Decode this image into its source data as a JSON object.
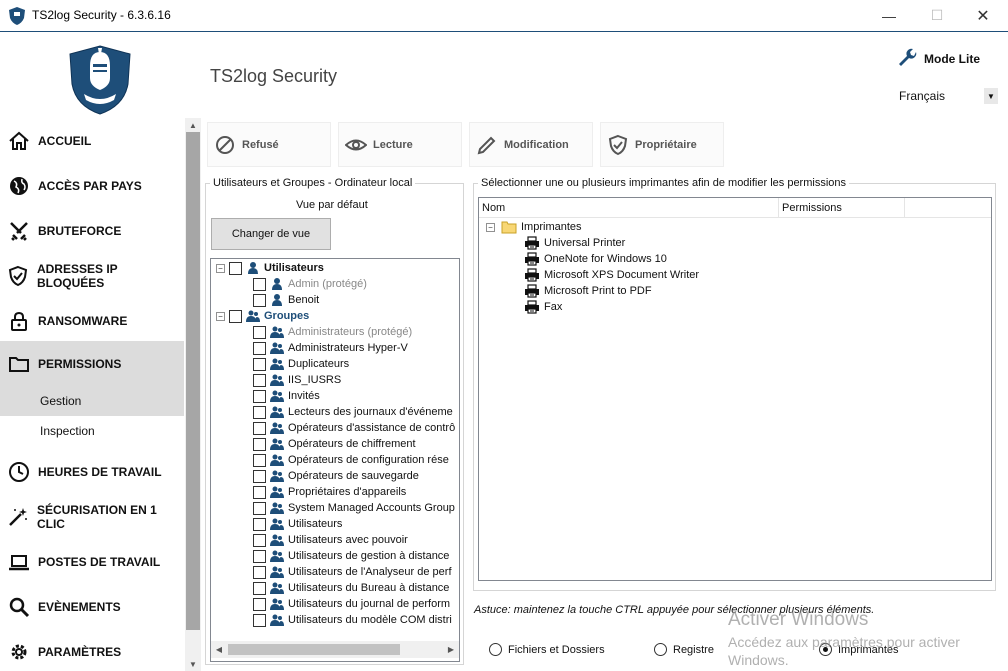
{
  "window": {
    "title": "TS2log Security - 6.3.6.16",
    "minimize_glyph": "—",
    "maximize_glyph": "☐",
    "close_glyph": "✕"
  },
  "header": {
    "app_name": "TS2log Security",
    "mode_lite": "Mode Lite",
    "language": "Français"
  },
  "sidebar": {
    "items": [
      {
        "label": "ACCUEIL",
        "icon": "home-icon"
      },
      {
        "label": "ACCÈS PAR PAYS",
        "icon": "globe-icon"
      },
      {
        "label": "BRUTEFORCE",
        "icon": "swords-icon"
      },
      {
        "label": "ADRESSES IP BLOQUÉES",
        "icon": "shield-check-icon"
      },
      {
        "label": "RANSOMWARE",
        "icon": "lock-icon"
      },
      {
        "label": "PERMISSIONS",
        "icon": "folder-icon",
        "active": true
      },
      {
        "label": "HEURES DE TRAVAIL",
        "icon": "clock-icon"
      },
      {
        "label": "SÉCURISATION EN 1 CLIC",
        "icon": "magic-wand-icon"
      },
      {
        "label": "POSTES DE TRAVAIL",
        "icon": "laptop-icon"
      },
      {
        "label": "EVÈNEMENTS",
        "icon": "magnifier-icon"
      },
      {
        "label": "PARAMÈTRES",
        "icon": "gear-icon"
      }
    ],
    "sub_items": [
      {
        "label": "Gestion",
        "active": true
      },
      {
        "label": "Inspection"
      }
    ]
  },
  "permissions": {
    "buttons": [
      {
        "label": "Refusé",
        "icon": "deny-icon"
      },
      {
        "label": "Lecture",
        "icon": "eye-icon"
      },
      {
        "label": "Modification",
        "icon": "pencil-icon"
      },
      {
        "label": "Propriétaire",
        "icon": "shield-check-icon"
      }
    ]
  },
  "users_panel": {
    "title": "Utilisateurs et Groupes - Ordinateur local",
    "view_label": "Vue par défaut",
    "change_view_button": "Changer de vue",
    "users_header": "Utilisateurs",
    "users": [
      {
        "name": "Admin (protégé)",
        "muted": true
      },
      {
        "name": "Benoit",
        "muted": false
      }
    ],
    "groups_header": "Groupes",
    "groups": [
      {
        "name": "Administrateurs (protégé)",
        "muted": true
      },
      {
        "name": "Administrateurs Hyper-V"
      },
      {
        "name": "Duplicateurs"
      },
      {
        "name": "IIS_IUSRS"
      },
      {
        "name": "Invités"
      },
      {
        "name": "Lecteurs des journaux d'événeme"
      },
      {
        "name": "Opérateurs d'assistance de contrô"
      },
      {
        "name": "Opérateurs de chiffrement"
      },
      {
        "name": "Opérateurs de configuration rése"
      },
      {
        "name": "Opérateurs de sauvegarde"
      },
      {
        "name": "Propriétaires d'appareils"
      },
      {
        "name": "System Managed Accounts Group"
      },
      {
        "name": "Utilisateurs"
      },
      {
        "name": "Utilisateurs avec pouvoir"
      },
      {
        "name": "Utilisateurs de gestion à distance"
      },
      {
        "name": "Utilisateurs de l'Analyseur de perf"
      },
      {
        "name": "Utilisateurs du Bureau à distance"
      },
      {
        "name": "Utilisateurs du journal de perform"
      },
      {
        "name": "Utilisateurs du modèle COM distri"
      }
    ]
  },
  "printers_panel": {
    "title": "Sélectionner une ou plusieurs imprimantes afin de modifier les permissions",
    "col_name": "Nom",
    "col_permissions": "Permissions",
    "root": "Imprimantes",
    "printers": [
      "Universal Printer",
      "OneNote for Windows 10",
      "Microsoft XPS Document Writer",
      "Microsoft Print to PDF",
      "Fax"
    ]
  },
  "hint": "Astuce: maintenez la touche CTRL appuyée pour sélectionner plusieurs éléments.",
  "radios": [
    {
      "label": "Fichiers et Dossiers",
      "checked": false
    },
    {
      "label": "Registre",
      "checked": false
    },
    {
      "label": "Imprimantes",
      "checked": true
    }
  ],
  "watermark": {
    "line1": "Activer Windows",
    "line2": "Accédez aux paramètres pour activer Windows."
  },
  "colors": {
    "brand": "#1e4e79",
    "active_nav": "#dcdcdc"
  }
}
